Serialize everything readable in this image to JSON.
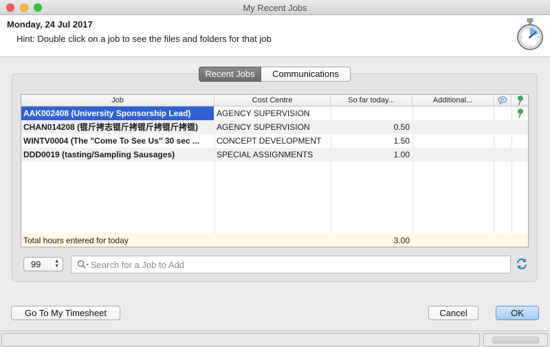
{
  "window": {
    "title": "My Recent Jobs"
  },
  "header": {
    "date": "Monday, 24 Jul 2017",
    "hint": "Hint: Double click on a job to see the files and folders for that job"
  },
  "tabs": [
    {
      "label": "Recent Jobs",
      "selected": true
    },
    {
      "label": "Communications",
      "selected": false
    }
  ],
  "table": {
    "columns": [
      "Job",
      "Cost Centre",
      "So far today...",
      "Additional..."
    ],
    "rows": [
      {
        "job": "AAK002408 (University Sponsorship Lead)",
        "cost_centre": "AGENCY SUPERVISION",
        "so_far": "",
        "additional": "",
        "selected": true
      },
      {
        "job": "CHAN014208 (锟斤拷志锟斤拷锟斤拷锟斤拷锟)",
        "cost_centre": "AGENCY SUPERVISION",
        "so_far": "0.50",
        "additional": ""
      },
      {
        "job": "WINTV0004 (The \"Come To See Us\" 30 sec ...",
        "cost_centre": "CONCEPT DEVELOPMENT",
        "so_far": "1.50",
        "additional": ""
      },
      {
        "job": "DDD0019 (tasting/Sampling Sausages)",
        "cost_centre": "SPECIAL ASSIGNMENTS",
        "so_far": "1.00",
        "additional": ""
      }
    ],
    "totals": {
      "label": "Total hours entered for today",
      "value": "3.00"
    }
  },
  "controls": {
    "count_value": "99",
    "search_placeholder": "Search for a Job to Add"
  },
  "buttons": {
    "timesheet": "Go To My Timesheet",
    "cancel": "Cancel",
    "ok": "OK"
  },
  "colors": {
    "selection": "#2f62d6",
    "totals_row": "#fdfbe0",
    "default_button": "#a3ccf6"
  },
  "icons": {
    "header": "stopwatch-icon",
    "column_comment": "speech-bubble-icon",
    "column_pin": "pin-icon",
    "search": "magnifier-icon",
    "refresh": "refresh-icon"
  }
}
